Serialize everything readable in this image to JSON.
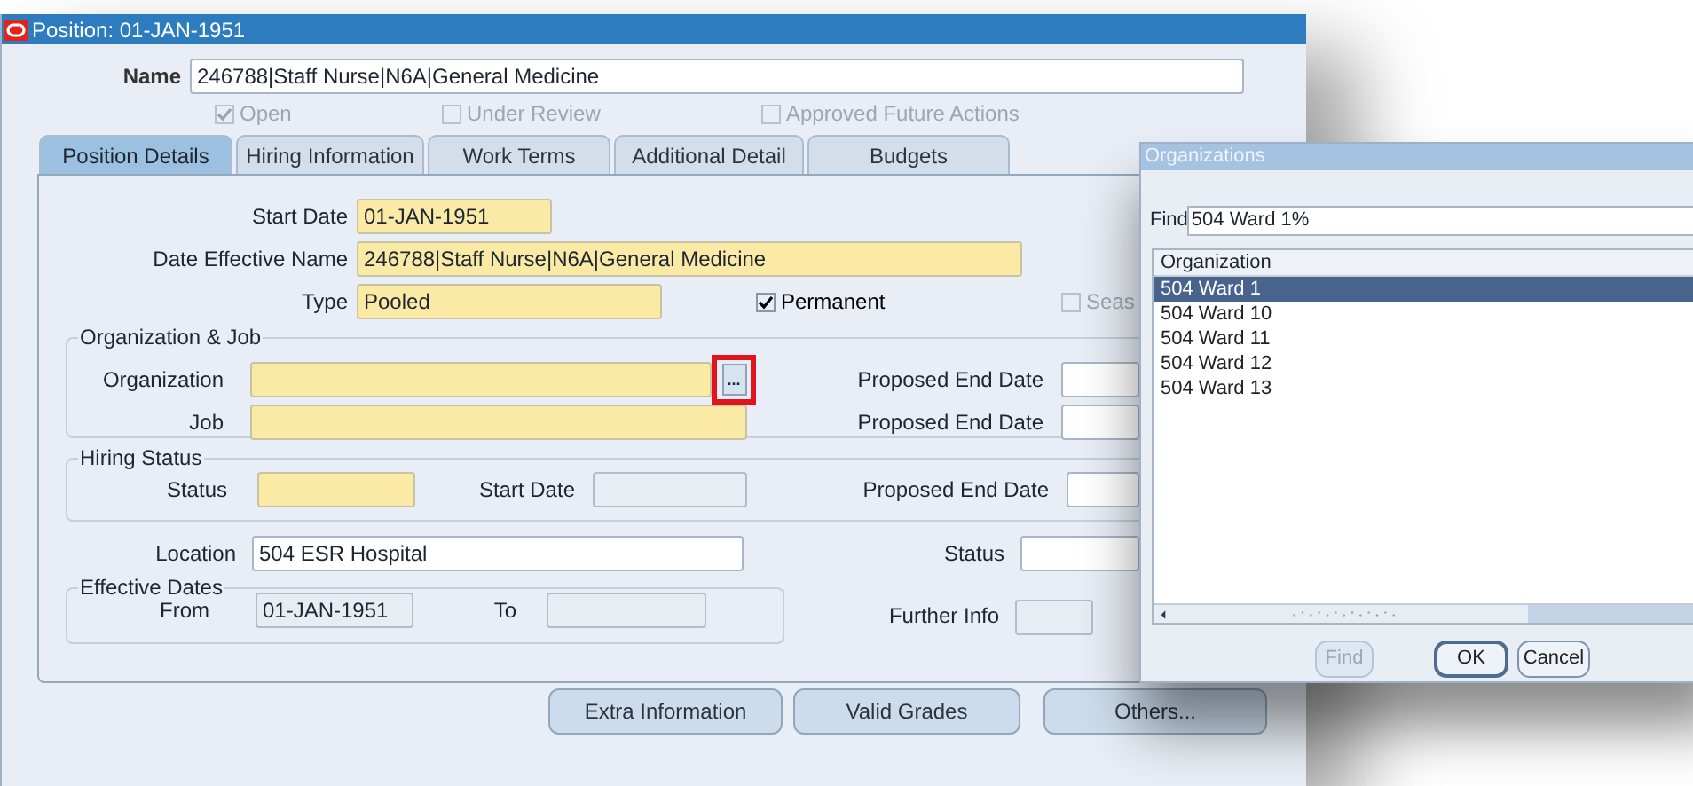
{
  "window": {
    "title": "Position: 01-JAN-1951"
  },
  "name_field": {
    "label": "Name",
    "value": "246788|Staff Nurse|N6A|General Medicine",
    "kind": "optional"
  },
  "flags": [
    {
      "label": "Open",
      "checked": true,
      "disabled": true
    },
    {
      "label": "Under Review",
      "checked": false,
      "disabled": true
    },
    {
      "label": "Approved Future Actions",
      "checked": false,
      "disabled": true
    }
  ],
  "tabs": [
    {
      "label": "Position Details",
      "selected": true
    },
    {
      "label": "Hiring Information",
      "selected": false
    },
    {
      "label": "Work Terms",
      "selected": false
    },
    {
      "label": "Additional Detail",
      "selected": false
    },
    {
      "label": "Budgets",
      "selected": false
    }
  ],
  "details": {
    "start_date": {
      "label": "Start Date",
      "value": "01-JAN-1951",
      "kind": "required"
    },
    "date_effective_name": {
      "label": "Date Effective Name",
      "value": "246788|Staff Nurse|N6A|General Medicine",
      "kind": "required"
    },
    "type": {
      "label": "Type",
      "value": "Pooled",
      "kind": "required"
    },
    "type_flags": [
      {
        "label": "Permanent",
        "checked": true,
        "disabled": false
      },
      {
        "label": "Seas",
        "checked": false,
        "disabled": true
      }
    ],
    "organization_job": {
      "title": "Organization & Job",
      "organization": {
        "label": "Organization",
        "kind": "required"
      },
      "lov_button": {
        "label": "...",
        "highlighted": true
      },
      "organization_end": {
        "label": "Proposed End Date",
        "kind": "optional"
      },
      "job": {
        "label": "Job",
        "kind": "required"
      },
      "job_end": {
        "label": "Proposed End Date",
        "kind": "optional"
      }
    },
    "hiring_status": {
      "title": "Hiring Status",
      "status": {
        "label": "Status",
        "kind": "required"
      },
      "start_date": {
        "label": "Start Date",
        "kind": "readonly"
      },
      "end_date": {
        "label": "Proposed End Date",
        "kind": "optional"
      }
    },
    "location": {
      "label": "Location",
      "value": "504 ESR Hospital",
      "kind": "optional"
    },
    "status": {
      "label": "Status",
      "kind": "optional"
    },
    "effective_dates": {
      "title": "Effective Dates",
      "from": {
        "label": "From",
        "value": "01-JAN-1951",
        "kind": "readonly"
      },
      "to": {
        "label": "To",
        "kind": "readonly"
      }
    },
    "further_info": {
      "label": "Further Info",
      "kind": "readonly"
    }
  },
  "buttons": [
    "Extra Information",
    "Valid Grades",
    "Others..."
  ],
  "dialog": {
    "title": "Organizations",
    "find": {
      "label": "Find",
      "value": "504 Ward 1%"
    },
    "column": "Organization",
    "rows": [
      {
        "label": "504 Ward 1",
        "selected": true
      },
      {
        "label": "504 Ward 10",
        "selected": false
      },
      {
        "label": "504 Ward 11",
        "selected": false
      },
      {
        "label": "504 Ward 12",
        "selected": false
      },
      {
        "label": "504 Ward 13",
        "selected": false
      }
    ],
    "buttons": [
      {
        "label": "Find",
        "disabled": true,
        "default": false
      },
      {
        "label": "OK",
        "disabled": false,
        "default": true
      },
      {
        "label": "Cancel",
        "disabled": false,
        "default": false
      }
    ]
  }
}
